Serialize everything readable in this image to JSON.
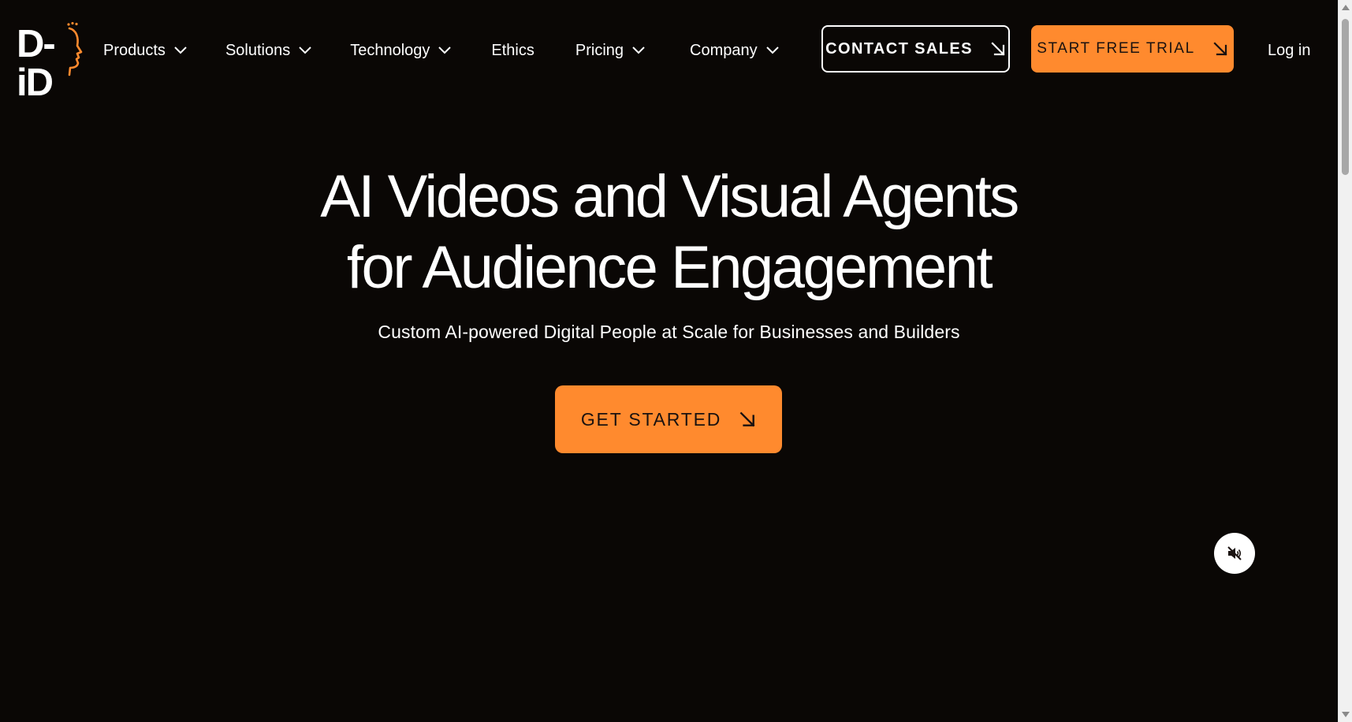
{
  "brand": {
    "logo_text": "D-iD",
    "accent_color": "#ff8a2e",
    "background_color": "#0a0705"
  },
  "nav": {
    "items": [
      {
        "label": "Products",
        "has_dropdown": true
      },
      {
        "label": "Solutions",
        "has_dropdown": true
      },
      {
        "label": "Technology",
        "has_dropdown": true
      },
      {
        "label": "Ethics",
        "has_dropdown": false
      },
      {
        "label": "Pricing",
        "has_dropdown": true
      },
      {
        "label": "Company",
        "has_dropdown": true
      }
    ],
    "contact_sales_label": "CONTACT SALES",
    "start_trial_label": "START FREE TRIAL",
    "login_label": "Log in"
  },
  "hero": {
    "title_line1": "AI Videos and Visual Agents",
    "title_line2": "for Audience Engagement",
    "subtitle": "Custom AI-powered Digital People at Scale for Businesses and Builders",
    "cta_label": "GET STARTED"
  },
  "icons": {
    "dropdown": "chevron-down-icon",
    "cta_arrow": "arrow-down-right-icon",
    "mute": "speaker-muted-icon"
  }
}
